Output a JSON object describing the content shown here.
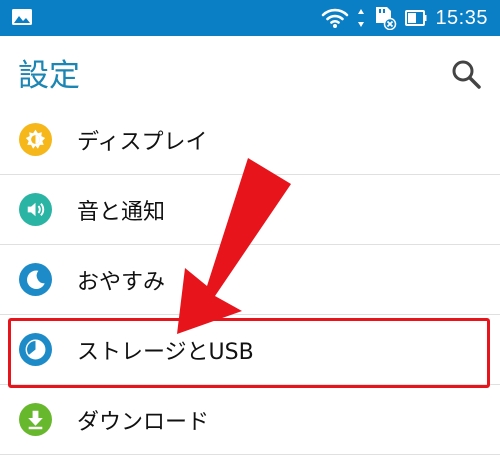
{
  "status_bar": {
    "time": "15:35",
    "icons": [
      "gallery-icon",
      "wifi-icon",
      "sd-card-icon",
      "battery-icon"
    ]
  },
  "app_bar": {
    "title": "設定",
    "search_icon": "search-icon"
  },
  "settings": {
    "items": [
      {
        "label": "ディスプレイ",
        "icon": "display-icon",
        "icon_color": "#f5b71a"
      },
      {
        "label": "音と通知",
        "icon": "sound-icon",
        "icon_color": "#2ab4a4"
      },
      {
        "label": "おやすみ",
        "icon": "moon-icon",
        "icon_color": "#1c8bc8"
      },
      {
        "label": "ストレージとUSB",
        "icon": "storage-icon",
        "icon_color": "#1c8bc8"
      },
      {
        "label": "ダウンロード",
        "icon": "download-icon",
        "icon_color": "#68b82e"
      }
    ]
  },
  "annotations": {
    "highlight_color": "#e8141c",
    "highlighted_item": "ストレージとUSB",
    "arrow_color": "#e8141c"
  },
  "colors": {
    "status_bar": "#0a7fc6",
    "title": "#1b86b3"
  }
}
